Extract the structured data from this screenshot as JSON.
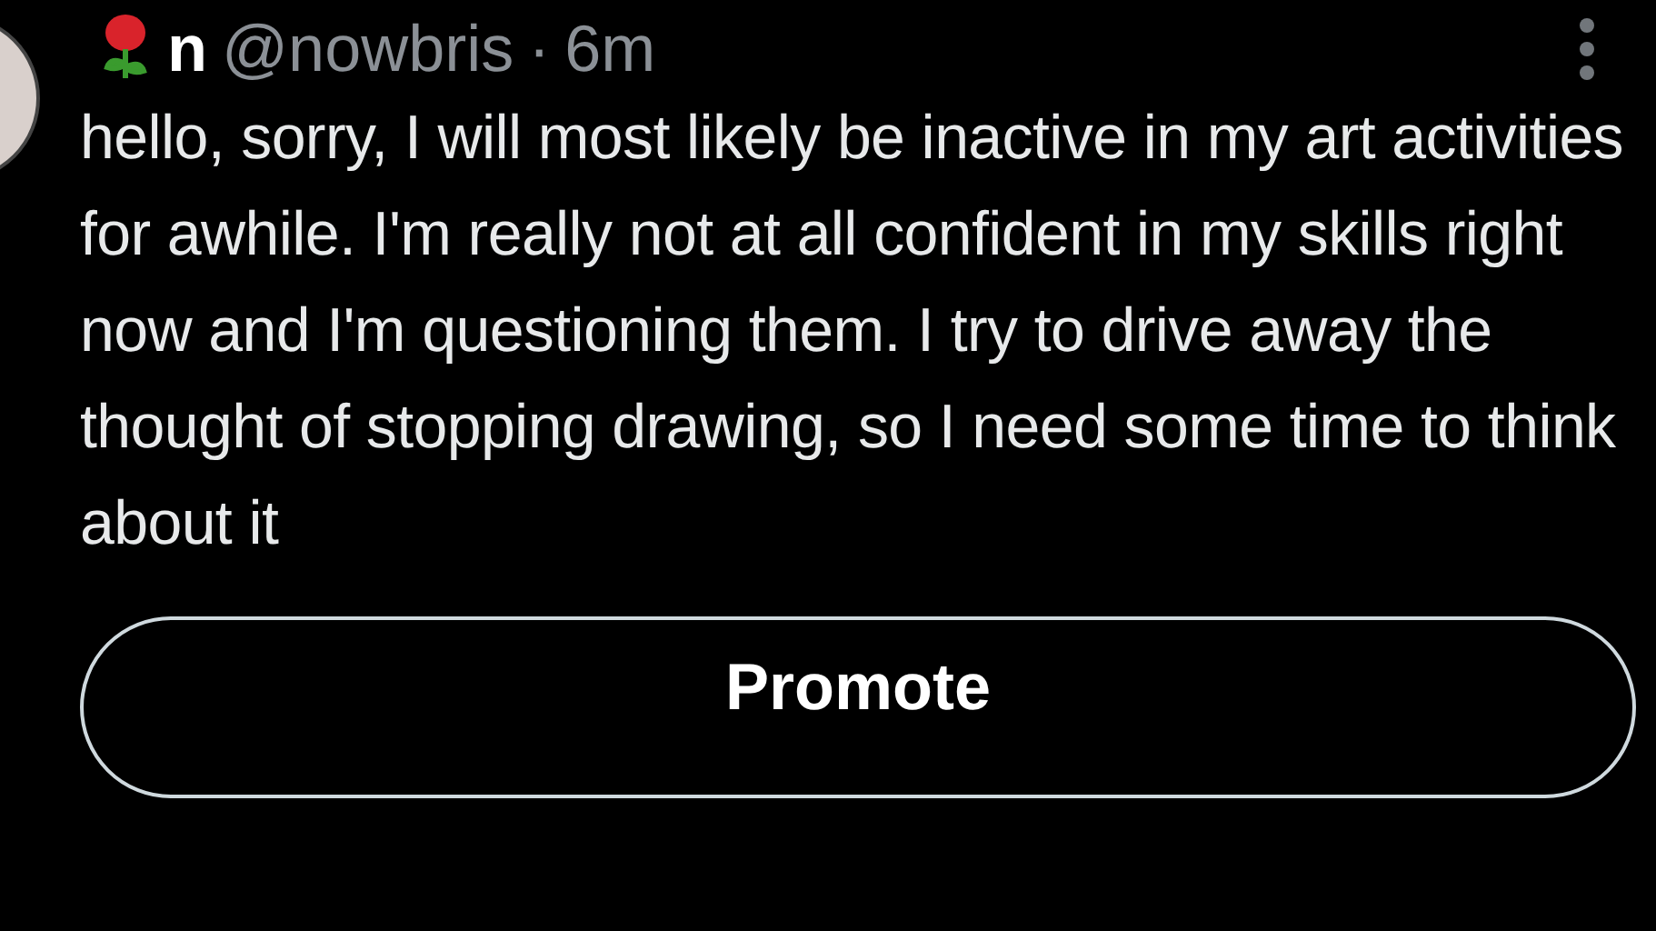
{
  "tweet": {
    "display_name": "n",
    "handle": "@nowbris",
    "separator": "·",
    "time": "6m",
    "text": "hello, sorry, I will most likely be inactive in my art activities for awhile. I'm really not at all confident in my skills right now and I'm questioning them. I try to drive away the thought of stopping drawing, so I need some time to think about it"
  },
  "button": {
    "label": "Promote"
  }
}
